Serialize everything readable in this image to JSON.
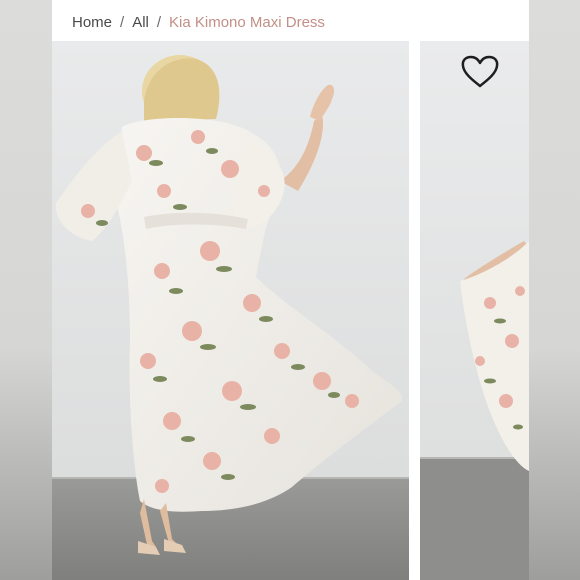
{
  "breadcrumb": {
    "items": [
      {
        "label": "Home"
      },
      {
        "label": "All"
      }
    ],
    "separator": "/",
    "current": "Kia Kimono Maxi Dress"
  },
  "icons": {
    "favorite": "heart-outline-icon"
  },
  "colors": {
    "breadcrumb_current": "#c28f87",
    "breadcrumb_text": "#4a4a4a",
    "wall": "#e4e5e6",
    "floor": "#8d8e8c",
    "dress": "#f4f2ee",
    "flower_pink": "#e8b3a6",
    "leaf_green": "#7d8a5e"
  }
}
